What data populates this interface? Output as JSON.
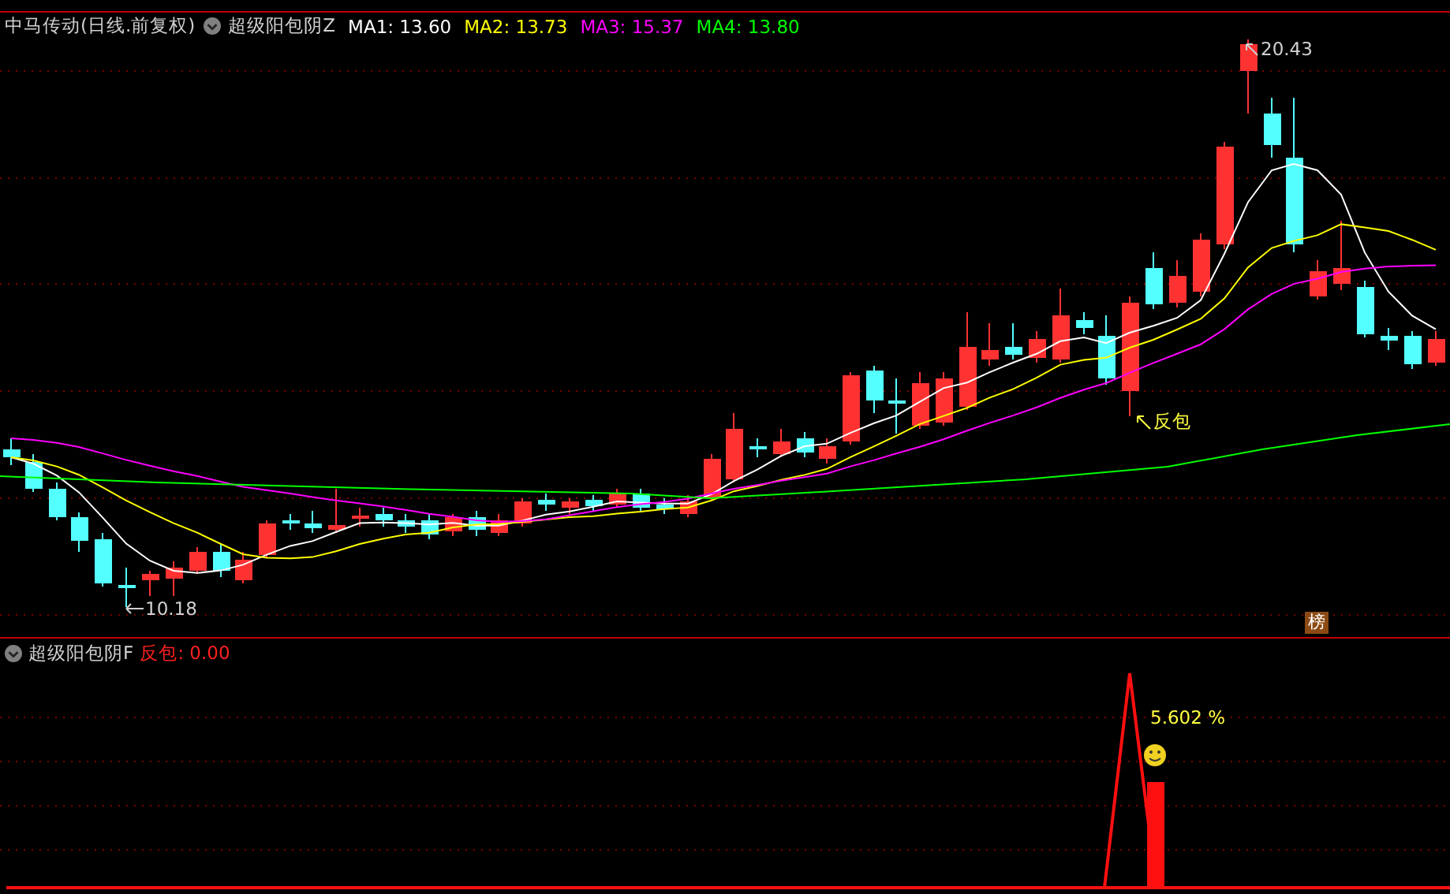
{
  "title_bar": {
    "stock": "中马传动(日线.前复权)",
    "indicator": "超级阳包阴Z",
    "ma": [
      {
        "label": "MA1:",
        "value": "13.60",
        "color": "#ffffff"
      },
      {
        "label": "MA2:",
        "value": "13.73",
        "color": "#ffff00"
      },
      {
        "label": "MA3:",
        "value": "15.37",
        "color": "#ff00ff"
      },
      {
        "label": "MA4:",
        "value": "13.80",
        "color": "#00ff00"
      }
    ]
  },
  "main_chart": {
    "high_label": "20.43",
    "low_label": "10.18",
    "signal_label": "反包",
    "badge": "榜"
  },
  "sub_panel": {
    "indicator": "超级阳包阴F",
    "series_label": "反包:",
    "series_value": "0.00",
    "percent_label": "5.602 %"
  }
}
